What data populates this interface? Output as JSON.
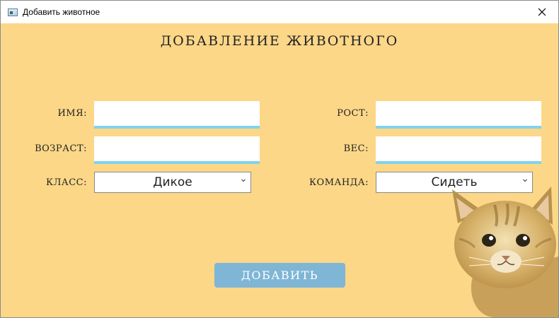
{
  "window": {
    "title": "Добавить животное",
    "close_glyph": "✕"
  },
  "form": {
    "heading": "ДОБАВЛЕНИЕ ЖИВОТНОГО",
    "fields": {
      "name": {
        "label": "ИМЯ:",
        "value": ""
      },
      "age": {
        "label": "ВОЗРАСТ:",
        "value": ""
      },
      "height": {
        "label": "РОСТ:",
        "value": ""
      },
      "weight": {
        "label": "ВЕС:",
        "value": ""
      }
    },
    "selects": {
      "class": {
        "label": "КЛАСС:",
        "value": "Дикое"
      },
      "command": {
        "label": "КОМАНДА:",
        "value": "Сидеть"
      }
    },
    "submit_label": "ДОБАВИТЬ"
  },
  "colors": {
    "background": "#fcd788",
    "input_underline": "#7fd3ef",
    "button": "#7fb6d6"
  },
  "icons": {
    "window_icon": "app-window-icon",
    "close": "close-icon",
    "dropdown": "chevron-down-icon",
    "decoration": "kitten-illustration"
  }
}
